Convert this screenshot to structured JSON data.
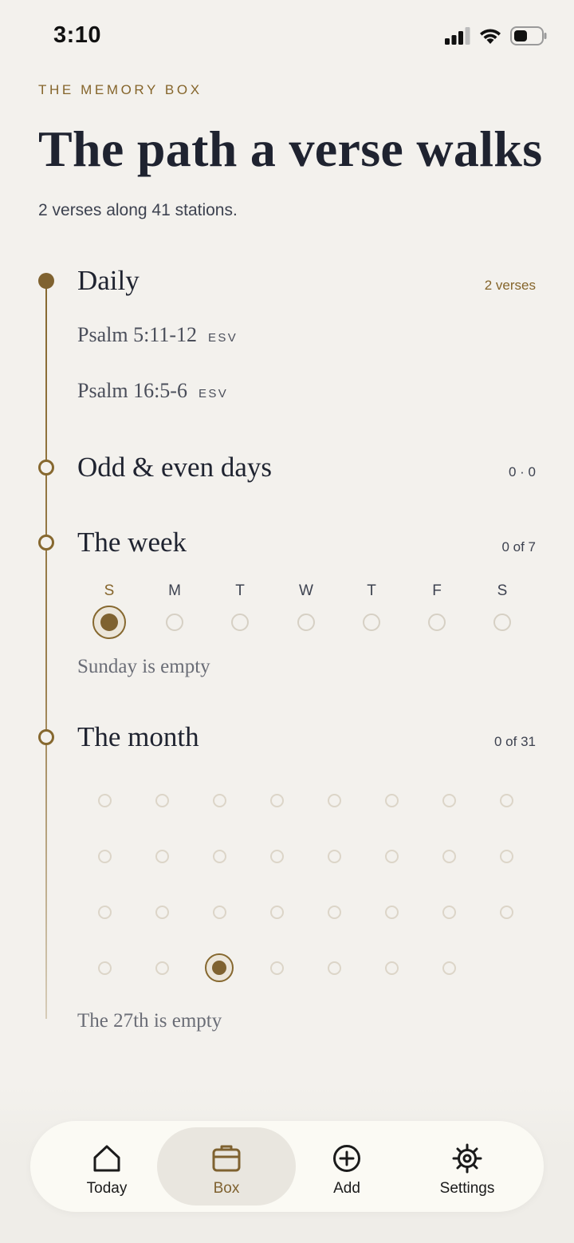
{
  "status_bar": {
    "time": "3:10"
  },
  "header": {
    "eyebrow": "THE MEMORY BOX",
    "title": "The path a verse walks",
    "subtitle": "2 verses along 41 stations."
  },
  "sections": {
    "daily": {
      "title": "Daily",
      "count": "2 verses",
      "verses": [
        {
          "reference": "Psalm 5:11-12",
          "translation": "ESV"
        },
        {
          "reference": "Psalm 16:5-6",
          "translation": "ESV"
        }
      ]
    },
    "odd_even": {
      "title": "Odd & even days",
      "count": "0 · 0"
    },
    "week": {
      "title": "The week",
      "count": "0 of 7",
      "days": [
        "S",
        "M",
        "T",
        "W",
        "T",
        "F",
        "S"
      ],
      "selected_index": 0,
      "empty_note": "Sunday is empty"
    },
    "month": {
      "title": "The month",
      "count": "0 of 31",
      "total_days": 31,
      "selected_day": 27,
      "empty_note": "The 27th is empty"
    }
  },
  "tabbar": {
    "tabs": [
      {
        "label": "Today",
        "icon": "home-icon"
      },
      {
        "label": "Box",
        "icon": "box-icon",
        "active": true
      },
      {
        "label": "Add",
        "icon": "add-circle-icon"
      },
      {
        "label": "Settings",
        "icon": "gear-icon"
      }
    ]
  },
  "colors": {
    "accent": "#85652b",
    "background": "#f3f1ed",
    "text": "#1f2330"
  }
}
